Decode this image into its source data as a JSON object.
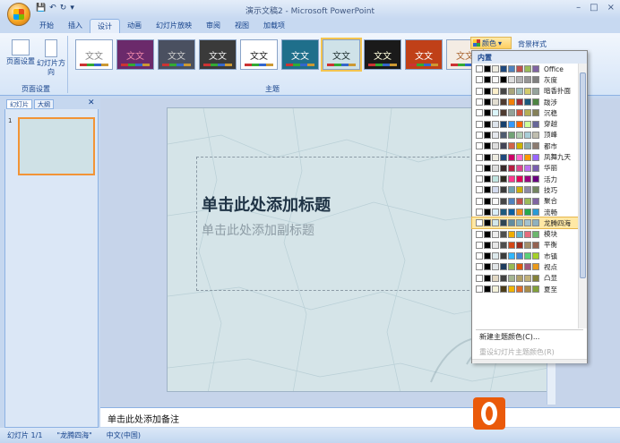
{
  "window": {
    "title": "演示文稿2 - Microsoft PowerPoint",
    "controls": [
      "–",
      "□",
      "×"
    ]
  },
  "qat": {
    "save": "💾",
    "undo": "↶",
    "redo": "↻",
    "more": "▾"
  },
  "tabs": [
    "开始",
    "插入",
    "设计",
    "动画",
    "幻灯片放映",
    "审阅",
    "视图",
    "加载项"
  ],
  "active_tab": "设计",
  "page_setup": {
    "btn1": "页面设置",
    "btn2": "幻灯片方向",
    "group": "页面设置"
  },
  "themes": {
    "group": "主题",
    "items": [
      {
        "label": "文文",
        "bg": "#ffffff",
        "fg": "#888"
      },
      {
        "label": "文文",
        "bg": "#6b2a6b",
        "fg": "#e8a"
      },
      {
        "label": "文文",
        "bg": "#4a5060",
        "fg": "#ccc"
      },
      {
        "label": "文文",
        "bg": "#3a3a3a",
        "fg": "#eee"
      },
      {
        "label": "文文",
        "bg": "#ffffff",
        "fg": "#222"
      },
      {
        "label": "文文",
        "bg": "#1f6f8b",
        "fg": "#fff"
      },
      {
        "label": "文文",
        "bg": "#cfe2e8",
        "fg": "#233"
      },
      {
        "label": "文文",
        "bg": "#1a1a1a",
        "fg": "#ffd"
      },
      {
        "label": "文文",
        "bg": "#c04018",
        "fg": "#fff"
      },
      {
        "label": "文文",
        "bg": "#f4ece4",
        "fg": "#a63"
      }
    ]
  },
  "colors_btn": "颜色",
  "effects_hint": "背景样式",
  "pane_tabs": {
    "slides": "幻灯片",
    "outline": "大纲",
    "close": "✕"
  },
  "thumb_num": "1",
  "slide": {
    "title": "单击此处添加标题",
    "subtitle": "单击此处添加副标题"
  },
  "notes": "单击此处添加备注",
  "status": {
    "slide": "幻灯片 1/1",
    "theme": "\"龙腾四海\"",
    "lang": "中文(中国)"
  },
  "dropdown": {
    "header": "内置",
    "new": "新建主题颜色(C)...",
    "reset": "重设幻灯片主题颜色(R)",
    "selected": "龙腾四海",
    "items": [
      {
        "name": "Office",
        "c": [
          "#fff",
          "#000",
          "#eeece1",
          "#1f497d",
          "#4f81bd",
          "#c0504d",
          "#9bbb59",
          "#8064a2"
        ]
      },
      {
        "name": "灰度",
        "c": [
          "#fff",
          "#000",
          "#f8f8f8",
          "#000",
          "#ddd",
          "#b2b2b2",
          "#969696",
          "#808080"
        ]
      },
      {
        "name": "暗香扑面",
        "c": [
          "#fff",
          "#000",
          "#fbeec9",
          "#464646",
          "#a9a57c",
          "#9cbebd",
          "#d2cb6c",
          "#95a39d"
        ]
      },
      {
        "name": "跋涉",
        "c": [
          "#fff",
          "#000",
          "#e3ded1",
          "#4e3b30",
          "#f07f09",
          "#9f2936",
          "#1b587c",
          "#4e8542"
        ]
      },
      {
        "name": "沉稳",
        "c": [
          "#fff",
          "#000",
          "#dbf5f9",
          "#4e3b30",
          "#93a299",
          "#cf543f",
          "#b5ae53",
          "#848058"
        ]
      },
      {
        "name": "穿越",
        "c": [
          "#fff",
          "#000",
          "#dde4ec",
          "#17406d",
          "#3399ff",
          "#ff6600",
          "#ccff99",
          "#666699"
        ]
      },
      {
        "name": "顶峰",
        "c": [
          "#fff",
          "#000",
          "#e5e8ed",
          "#4e5b6f",
          "#72a376",
          "#b0ccb0",
          "#a8cdd7",
          "#c0beaf"
        ]
      },
      {
        "name": "都市",
        "c": [
          "#fff",
          "#000",
          "#dedede",
          "#424456",
          "#d16349",
          "#ccb400",
          "#8cadae",
          "#8c7b70"
        ]
      },
      {
        "name": "凤舞九天",
        "c": [
          "#fff",
          "#000",
          "#eeece1",
          "#1f497d",
          "#cc0066",
          "#ff66cc",
          "#ff9900",
          "#9966ff"
        ]
      },
      {
        "name": "华丽",
        "c": [
          "#fff",
          "#000",
          "#ddd",
          "#382a2a",
          "#b71e42",
          "#de478e",
          "#bc72f0",
          "#795faf"
        ]
      },
      {
        "name": "活力",
        "c": [
          "#fff",
          "#000",
          "#c0e4e0",
          "#2e2b21",
          "#ff388c",
          "#e40059",
          "#9c007f",
          "#68007f"
        ]
      },
      {
        "name": "技巧",
        "c": [
          "#fff",
          "#000",
          "#d2daee",
          "#3b3b3b",
          "#6ea0b0",
          "#ccaf0a",
          "#8d89a4",
          "#748560"
        ]
      },
      {
        "name": "聚合",
        "c": [
          "#fff",
          "#000",
          "#f8f8f8",
          "#464646",
          "#4f81bd",
          "#c0504d",
          "#9bbb59",
          "#8064a2"
        ]
      },
      {
        "name": "流畅",
        "c": [
          "#fff",
          "#000",
          "#dbeff9",
          "#1c5a7e",
          "#0a61a3",
          "#ef8d1c",
          "#24a94c",
          "#2a9ad6"
        ]
      },
      {
        "name": "龙腾四海",
        "c": [
          "#fff",
          "#000",
          "#d2e7e9",
          "#2f4553",
          "#638d9e",
          "#86b4c1",
          "#a4c2cf",
          "#8fb1bf"
        ]
      },
      {
        "name": "模块",
        "c": [
          "#fff",
          "#000",
          "#ededed",
          "#4e4e4e",
          "#f0ad00",
          "#60b5cc",
          "#e66c7d",
          "#6bb76d"
        ]
      },
      {
        "name": "平衡",
        "c": [
          "#fff",
          "#000",
          "#e7e7e7",
          "#4e4e4e",
          "#d34817",
          "#9b2d1f",
          "#a28e6a",
          "#956251"
        ]
      },
      {
        "name": "市镇",
        "c": [
          "#fff",
          "#000",
          "#dde9ec",
          "#3c3c3c",
          "#31b6fd",
          "#4584d3",
          "#5bd078",
          "#a5d028"
        ]
      },
      {
        "name": "视点",
        "c": [
          "#fff",
          "#000",
          "#e2e6e8",
          "#1e3c5e",
          "#98b954",
          "#e05a0a",
          "#a05a7e",
          "#ea9a1a"
        ]
      },
      {
        "name": "凸显",
        "c": [
          "#fff",
          "#000",
          "#e2d8c3",
          "#424242",
          "#a4b592",
          "#b1a069",
          "#c1b17a",
          "#84813a"
        ]
      },
      {
        "name": "夏至",
        "c": [
          "#fff",
          "#000",
          "#f3f1d8",
          "#4c3d1a",
          "#f0b400",
          "#e06c2a",
          "#a88c4a",
          "#82a03a"
        ]
      }
    ]
  }
}
